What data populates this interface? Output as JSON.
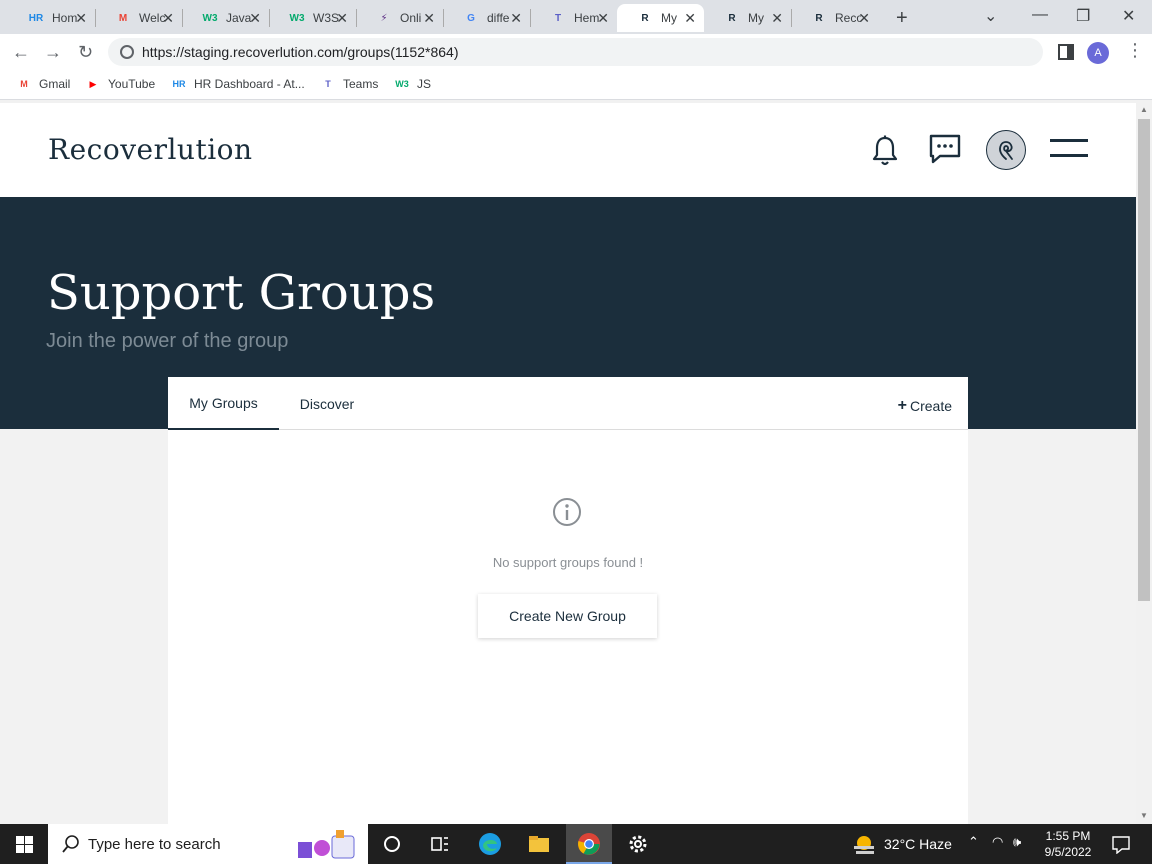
{
  "browser": {
    "tabs": [
      {
        "title": "Hom",
        "favicon": "HR",
        "favicon_color": "#1e88e5",
        "active": false
      },
      {
        "title": "Welc",
        "favicon": "M",
        "favicon_color": "#ea4335",
        "active": false
      },
      {
        "title": "Javas",
        "favicon": "W3",
        "favicon_color": "#04aa6d",
        "active": false
      },
      {
        "title": "W3S",
        "favicon": "W3",
        "favicon_color": "#04aa6d",
        "active": false
      },
      {
        "title": "Onli",
        "favicon": "⚡",
        "favicon_color": "#5b2d83",
        "active": false
      },
      {
        "title": "diffe",
        "favicon": "G",
        "favicon_color": "#4285f4",
        "active": false
      },
      {
        "title": "Hem",
        "favicon": "T",
        "favicon_color": "#5b5fc7",
        "active": false
      },
      {
        "title": "My",
        "favicon": "R",
        "favicon_color": "#1b2e3c",
        "active": true
      },
      {
        "title": "My",
        "favicon": "R",
        "favicon_color": "#1b2e3c",
        "active": false
      },
      {
        "title": "Reco",
        "favicon": "R",
        "favicon_color": "#1b2e3c",
        "active": false
      }
    ],
    "url": "https://staging.recoverlution.com/groups(1152*864)",
    "profile_initial": "A",
    "bookmarks": [
      {
        "label": "Gmail",
        "icon": "M",
        "color": "#ea4335"
      },
      {
        "label": "YouTube",
        "icon": "▶",
        "color": "#ff0000"
      },
      {
        "label": "HR Dashboard - At...",
        "icon": "HR",
        "color": "#1e88e5"
      },
      {
        "label": "Teams",
        "icon": "T",
        "color": "#5b5fc7"
      },
      {
        "label": "JS",
        "icon": "W3",
        "color": "#04aa6d"
      }
    ]
  },
  "site": {
    "logo": "Recoverlution",
    "hero_title": "Support Groups",
    "hero_subtitle": "Join the power of the group",
    "tabs": {
      "my_groups": "My Groups",
      "discover": "Discover"
    },
    "create_label": "Create",
    "empty_message": "No support groups found !",
    "create_group_button": "Create New Group",
    "colors": {
      "brand_dark": "#1b2e3c",
      "muted": "#7d8b95"
    }
  },
  "taskbar": {
    "search_placeholder": "Type here to search",
    "weather": "32°C  Haze",
    "time": "1:55 PM",
    "date": "9/5/2022"
  }
}
